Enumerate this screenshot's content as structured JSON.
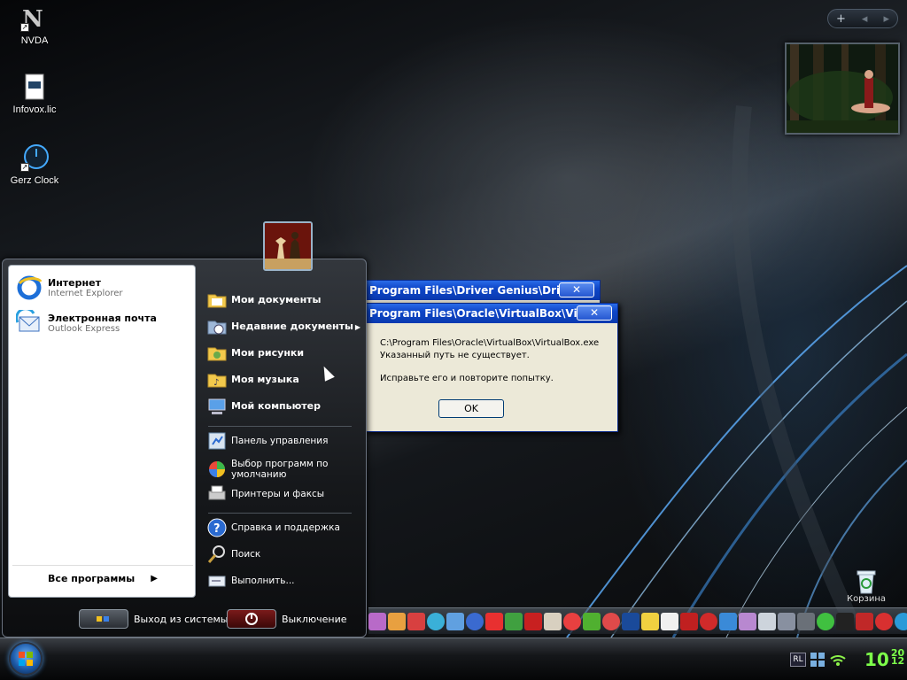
{
  "desktop": {
    "icons": [
      {
        "label": "NVDA",
        "icon": "nvda-icon"
      },
      {
        "label": "Infovox.lic",
        "icon": "document-icon"
      },
      {
        "label": "Gerz Clock",
        "icon": "clock-icon"
      }
    ],
    "gadget_bar": {
      "add": "+",
      "prev": "◂",
      "next": "▸"
    },
    "recycle_bin": {
      "label": "Корзина",
      "icon": "recycle-bin-icon"
    }
  },
  "start_menu": {
    "pinned": [
      {
        "title": "Интернет",
        "subtitle": "Internet Explorer",
        "icon": "internet-explorer-icon"
      },
      {
        "title": "Электронная почта",
        "subtitle": "Outlook Express",
        "icon": "outlook-express-icon"
      }
    ],
    "all_programs": "Все программы",
    "places": [
      {
        "label": "Мои документы",
        "icon": "my-documents-icon"
      },
      {
        "label": "Недавние документы",
        "icon": "recent-documents-icon",
        "submenu": true
      },
      {
        "label": "Мои рисунки",
        "icon": "my-pictures-icon"
      },
      {
        "label": "Моя музыка",
        "icon": "my-music-icon"
      },
      {
        "label": "Мой компьютер",
        "icon": "my-computer-icon"
      }
    ],
    "settings": [
      {
        "label": "Панель управления",
        "icon": "control-panel-icon"
      },
      {
        "label": "Выбор программ по умолчанию",
        "icon": "default-programs-icon"
      },
      {
        "label": "Принтеры и факсы",
        "icon": "printers-icon"
      }
    ],
    "help": [
      {
        "label": "Справка и поддержка",
        "icon": "help-icon"
      },
      {
        "label": "Поиск",
        "icon": "search-icon"
      },
      {
        "label": "Выполнить...",
        "icon": "run-icon"
      }
    ],
    "logoff": "Выход из системы",
    "shutdown": "Выключение"
  },
  "dialogs": {
    "back": {
      "title": "Program Files\\Driver Genius\\Drive..."
    },
    "main": {
      "title": "Program Files\\Oracle\\VirtualBox\\Vir...",
      "path": "C:\\Program Files\\Oracle\\VirtualBox\\VirtualBox.exe",
      "line1": "Указанный путь не существует.",
      "line2": "Исправьте его и повторите попытку.",
      "ok": "OK",
      "close": "✕"
    }
  },
  "taskbar": {
    "tray_lang": "RL",
    "clock_hour": "10",
    "clock_minute": "20",
    "clock_second": "12"
  },
  "colors": {
    "clock": "#7dff4a",
    "dialog_title": "#0e46c8"
  }
}
